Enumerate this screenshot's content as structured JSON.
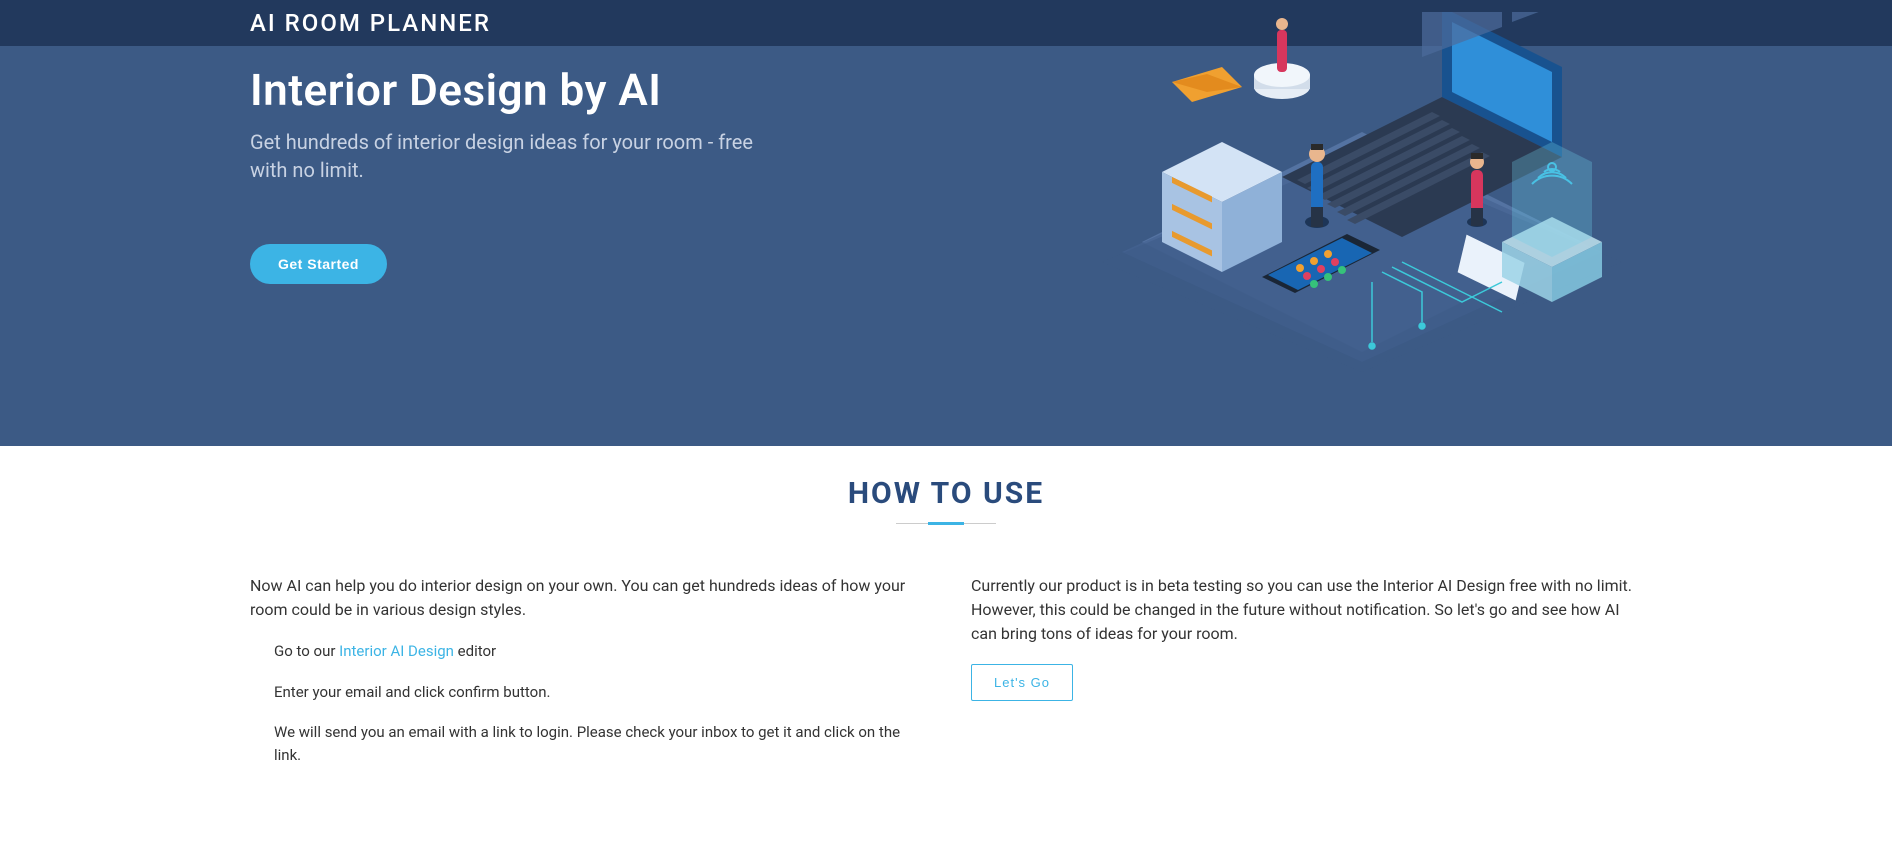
{
  "header": {
    "brand": "AI ROOM PLANNER"
  },
  "hero": {
    "title": "Interior Design by AI",
    "subtitle": "Get hundreds of interior design ideas for your room - free with no limit.",
    "cta": "Get Started"
  },
  "howto": {
    "title": "HOW TO USE",
    "intro": "Now AI can help you do interior design on your own. You can get hundreds ideas of how your room could be in various design styles.",
    "steps": [
      {
        "prefix": "Go to our ",
        "link": "Interior AI Design",
        "suffix": " editor"
      },
      {
        "text": "Enter your email and click confirm button."
      },
      {
        "text": "We will send you an email with a link to login. Please check your inbox to get it and click on the link."
      }
    ],
    "right_text": "Currently our product is in beta testing so you can use the Interior AI Design free with no limit. However, this could be changed in the future without notification. So let's go and see how AI can bring tons of ideas for your room.",
    "cta": "Let's Go"
  }
}
